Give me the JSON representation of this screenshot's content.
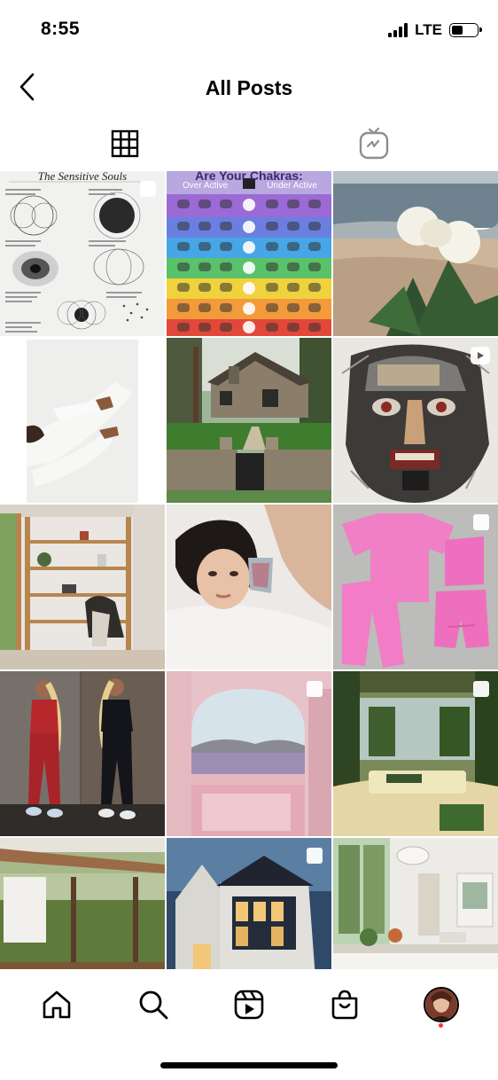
{
  "status_bar": {
    "time": "8:55",
    "network": "LTE"
  },
  "header": {
    "title": "All Posts"
  },
  "tabs": [
    {
      "name": "posts-grid",
      "icon": "grid-icon",
      "active": true
    },
    {
      "name": "igtv",
      "icon": "igtv-icon",
      "active": false
    }
  ],
  "posts": {
    "p1": {
      "title": "The Sensitive Souls",
      "multi": true
    },
    "p2": {
      "title": "Are Your Chakras:",
      "left": "Over Active",
      "right": "Under Active",
      "multi": false
    },
    "p3": {
      "multi": false
    },
    "p4": {
      "multi": false
    },
    "p5": {
      "multi": false
    },
    "p6": {
      "reel": true
    },
    "p7": {
      "multi": false
    },
    "p8": {
      "multi": false
    },
    "p9": {
      "multi": true
    },
    "p10": {
      "multi": false
    },
    "p11": {
      "multi": true
    },
    "p12": {
      "multi": true
    },
    "p13": {
      "multi": false
    },
    "p14": {
      "multi": true
    },
    "p15": {
      "multi": false
    }
  },
  "bottom_nav": [
    "home-icon",
    "search-icon",
    "reels-icon",
    "shop-icon",
    "profile-avatar"
  ],
  "colors": {
    "accent_dot": "#ff3040",
    "text": "#000000"
  }
}
